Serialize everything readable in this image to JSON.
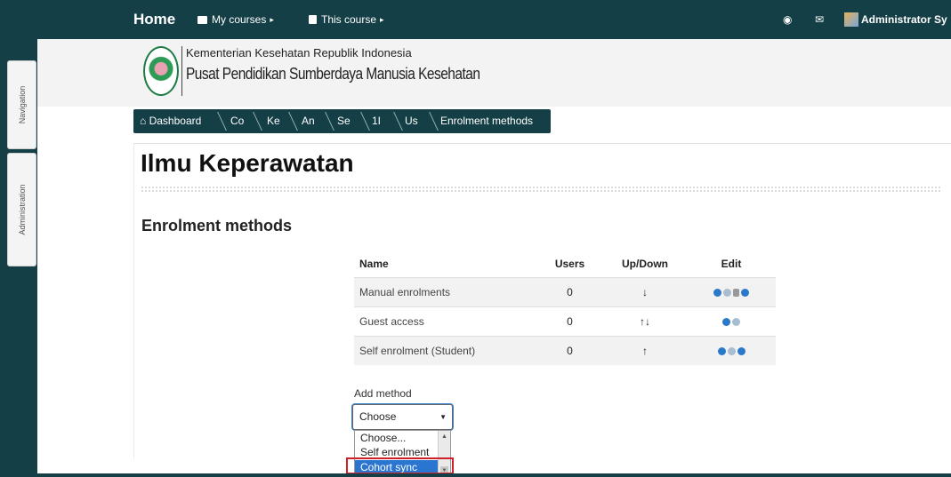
{
  "sidebar_tabs": {
    "navigation": "Navigation",
    "administration": "Administration"
  },
  "topbar": {
    "home": "Home",
    "my_courses": "My courses",
    "this_course": "This course",
    "user": "Administrator Sy"
  },
  "header": {
    "org_line1": "Kementerian Kesehatan Republik Indonesia",
    "org_line2": "Pusat Pendidikan Sumberdaya Manusia Kesehatan"
  },
  "breadcrumb": [
    "Dashboard",
    "Co",
    "Ke",
    "An",
    "Se",
    "1I",
    "Us",
    "Enrolment methods"
  ],
  "page": {
    "title": "Ilmu Keperawatan",
    "section_title": "Enrolment methods"
  },
  "table": {
    "headers": {
      "name": "Name",
      "users": "Users",
      "updown": "Up/Down",
      "edit": "Edit"
    },
    "rows": [
      {
        "name": "Manual enrolments",
        "users": "0",
        "updown": "↓"
      },
      {
        "name": "Guest access",
        "users": "0",
        "updown": "↑↓"
      },
      {
        "name": "Self enrolment (Student)",
        "users": "0",
        "updown": "↑"
      }
    ]
  },
  "add_method": {
    "label": "Add method",
    "selected": "Choose",
    "options": [
      "Choose...",
      "Self enrolment",
      "Cohort sync"
    ],
    "highlighted": "Cohort sync"
  },
  "colors": {
    "bar": "#153f46",
    "accent": "#2a79c9",
    "highlight_border": "#d0212b"
  },
  "icons": [
    "globe-icon",
    "mail-icon",
    "settings-icon",
    "eye-icon",
    "user-icon",
    "arrow-up-icon",
    "arrow-down-icon"
  ]
}
